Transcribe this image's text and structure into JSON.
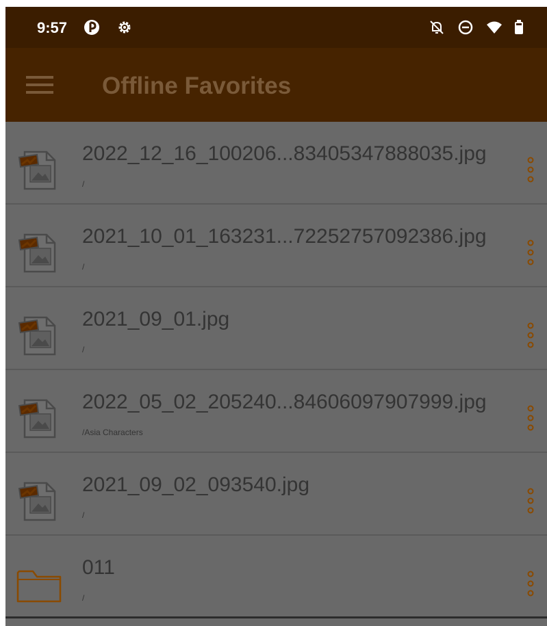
{
  "status_bar": {
    "time": "9:57",
    "icons": [
      "app-notification-icon",
      "settings-icon",
      "notifications-off-icon",
      "do-not-disturb-icon",
      "wifi-icon",
      "battery-icon"
    ]
  },
  "app_bar": {
    "menu_icon": "hamburger-menu-icon",
    "title": "Offline Favorites"
  },
  "colors": {
    "status_bar": "#3b1d00",
    "app_bar": "#462300",
    "title_text": "#7a5a39",
    "list_background": "#696969",
    "accent": "#8a4a00",
    "text": "#343434"
  },
  "items": [
    {
      "name": "2022_12_16_100206...83405347888035.jpg",
      "path": "/",
      "type": "image"
    },
    {
      "name": "2021_10_01_163231...72252757092386.jpg",
      "path": "/",
      "type": "image"
    },
    {
      "name": "2021_09_01.jpg",
      "path": "/",
      "type": "image"
    },
    {
      "name": "2022_05_02_205240...84606097907999.jpg",
      "path": "/Asia Characters",
      "type": "image"
    },
    {
      "name": "2021_09_02_093540.jpg",
      "path": "/",
      "type": "image"
    },
    {
      "name": "011",
      "path": "/",
      "type": "folder"
    }
  ]
}
